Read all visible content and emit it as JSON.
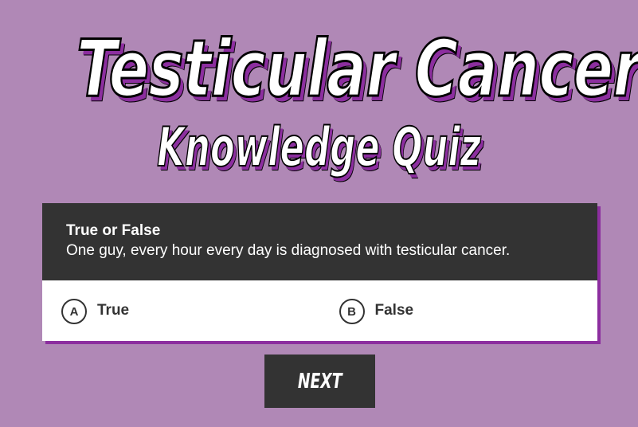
{
  "title": {
    "line1": "Testicular Cancer",
    "line2": "Knowledge Quiz"
  },
  "question": {
    "type": "True or False",
    "text": "One guy, every hour every day is diagnosed with testicular cancer.",
    "answers": [
      {
        "letter": "A",
        "label": "True"
      },
      {
        "letter": "B",
        "label": "False"
      }
    ]
  },
  "next_label": "NEXT",
  "colors": {
    "background": "#b088b6",
    "accent": "#8c2e9f",
    "dark": "#333333"
  }
}
